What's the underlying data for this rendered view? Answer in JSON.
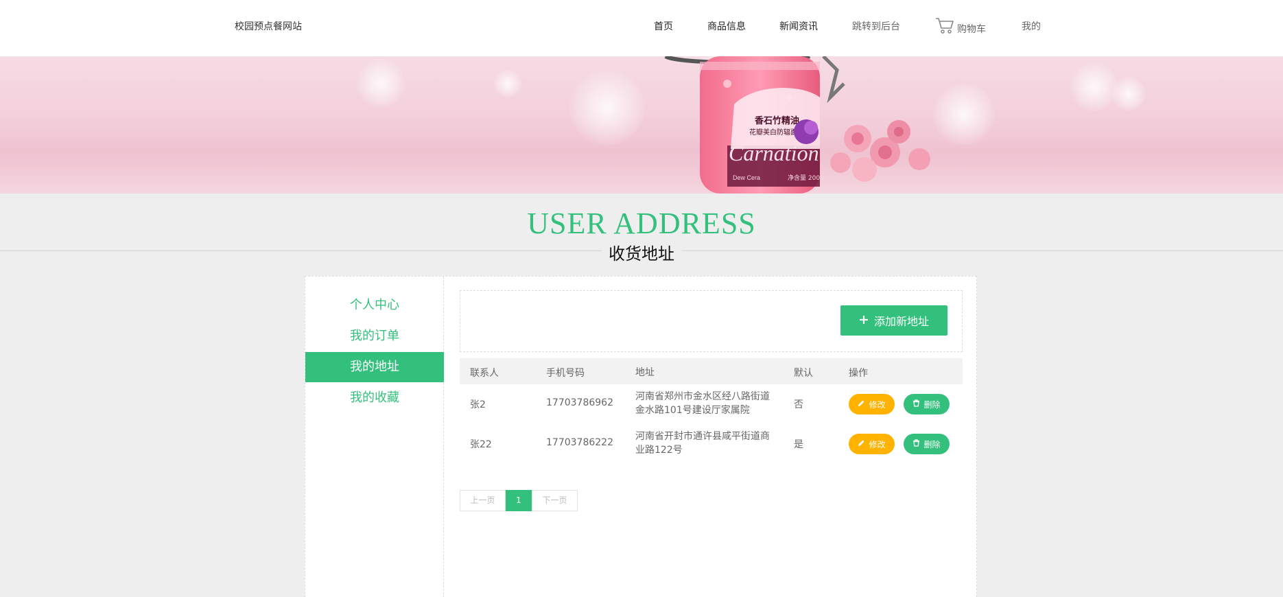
{
  "header": {
    "brand": "校园预点餐网站",
    "nav": {
      "home": "首页",
      "goods": "商品信息",
      "news": "新闻资讯",
      "admin": "跳转到后台",
      "cart": "购物车",
      "mine": "我的"
    }
  },
  "banner": {
    "jar_title": "香石竹精油",
    "jar_subtitle": "花瓣美白防辐面膜",
    "jar_brand": "Carnation",
    "jar_logo": "Dew Cera",
    "jar_weight": "净含量 200g"
  },
  "title": {
    "english": "USER ADDRESS",
    "chinese": "收货地址"
  },
  "sidebar": {
    "items": [
      {
        "label": "个人中心"
      },
      {
        "label": "我的订单"
      },
      {
        "label": "我的地址",
        "active": true
      },
      {
        "label": "我的收藏"
      }
    ]
  },
  "toolbar": {
    "add_label": "添加新地址"
  },
  "table": {
    "headers": [
      "联系人",
      "手机号码",
      "地址",
      "默认",
      "操作"
    ],
    "rows": [
      {
        "name": "张2",
        "phone": "17703786962",
        "address": "河南省郑州市金水区经八路街道金水路101号建设厅家属院",
        "default": "否",
        "edit": "修改",
        "delete": "删除"
      },
      {
        "name": "张22",
        "phone": "17703786222",
        "address": "河南省开封市通许县咸平街道商业路122号",
        "default": "是",
        "edit": "修改",
        "delete": "删除"
      }
    ]
  },
  "pager": {
    "prev": "上一页",
    "current": "1",
    "next": "下一页"
  },
  "colors": {
    "accent": "#33c07c",
    "edit": "#ffb300",
    "background": "#eeeeee"
  },
  "icons": {
    "cart": "cart-icon",
    "add": "plus-icon",
    "edit": "pencil-icon",
    "delete": "trash-icon"
  }
}
